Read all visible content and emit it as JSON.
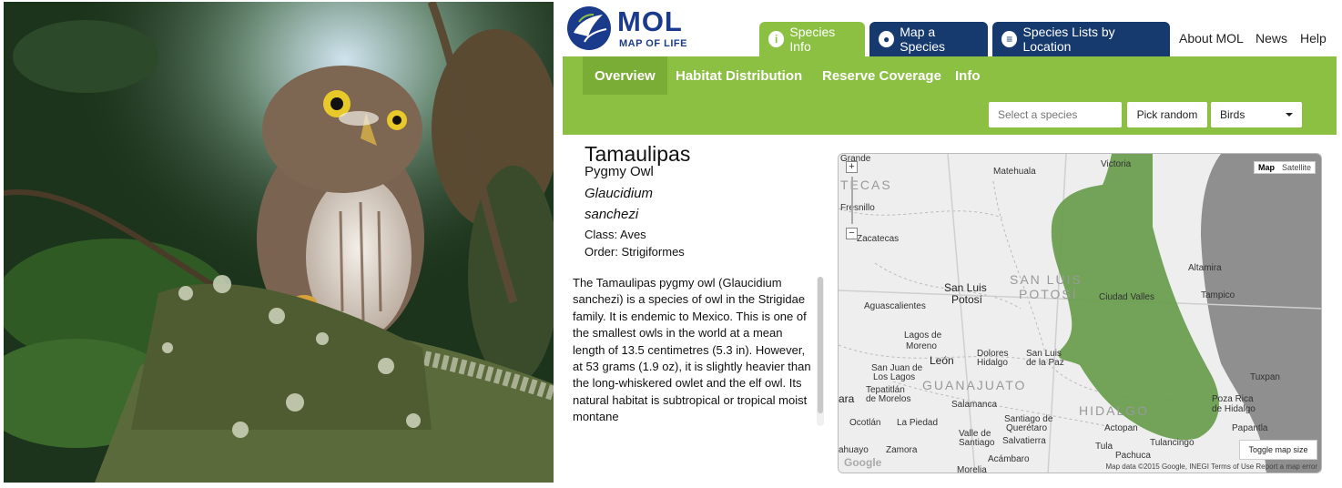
{
  "photo": {
    "alt_subject": "owl"
  },
  "logo": {
    "mol": "MOL",
    "subtitle": "MAP OF LIFE"
  },
  "tabs": [
    {
      "label": "Species Info",
      "icon": "info-icon"
    },
    {
      "label": "Map a Species",
      "icon": "map-pin-icon"
    },
    {
      "label": "Species Lists by Location",
      "icon": "list-icon"
    }
  ],
  "top_links": [
    "About MOL",
    "News",
    "Help"
  ],
  "subtabs": [
    "Overview",
    "Habitat Distribution",
    "Reserve Coverage",
    "Info"
  ],
  "search": {
    "placeholder": "Select a species"
  },
  "pick_random": "Pick random",
  "group_select": {
    "value": "Birds"
  },
  "species": {
    "common_line1": "Tamaulipas",
    "common_line2": "Pygmy Owl",
    "sci_line1": "Glaucidium",
    "sci_line2": "sanchezi",
    "class": "Class: Aves",
    "order": "Order: Strigiformes",
    "description": "The Tamaulipas pygmy owl (Glaucidium sanchezi) is a species of owl in the Strigidae family. It is endemic to Mexico. This is one of the smallest owls in the world at a mean length of 13.5 centimetres (5.3 in). However, at 53 grams (1.9 oz), it is slightly heavier than the long-whiskered owlet and the elf owl. Its natural habitat is subtropical or tropical moist montane"
  },
  "map": {
    "type_map": "Map",
    "type_satellite": "Satellite",
    "toggle": "Toggle map size",
    "attribution": "Map data ©2015 Google, INEGI   Terms of Use   Report a map error",
    "google": "Google",
    "zoom_in": "+",
    "zoom_out": "−",
    "range_color": "#6a9e4f",
    "labels": {
      "grande": "Grande",
      "tecas": "TECAS",
      "fresnillo": "Fresnillo",
      "zacatecas": "Zacatecas",
      "matehuala": "Matehuala",
      "victoria": "Victoria",
      "san_luis_state": "SAN LUIS",
      "potosi_state": "POTOSÍ",
      "san_luis_city": "San Luis",
      "potosi_city": "Potosí",
      "aguascalientes": "Aguascalientes",
      "ciudad_valles": "Ciudad Valles",
      "altamira": "Altamira",
      "tampico": "Tampico",
      "lagos_de": "Lagos de",
      "moreno": "Moreno",
      "leon": "León",
      "dolores": "Dolores",
      "hidalgo_city": "Hidalgo",
      "san_luis_paz": "San Luis",
      "de_la_paz": "de la Paz",
      "san_juan": "San Juan de",
      "los_lagos": "Los Lagos",
      "tepatitlan": "Tepatitlán",
      "de_morelos": "de Morelos",
      "ara": "ara",
      "guanajuato": "GUANAJUATO",
      "salamanca": "Salamanca",
      "hidalgo_state": "HIDALGO",
      "tuxpan": "Tuxpan",
      "poza_rica": "Poza Rica",
      "de_hidalgo": "de Hidalgo",
      "papantla": "Papantla",
      "ocotlan": "Ocotlán",
      "la_piedad": "La Piedad",
      "santiago_de": "Santiago de",
      "queretaro": "Querétaro",
      "valle_de": "Valle de",
      "santiago": "Santiago",
      "salvatierra": "Salvatierra",
      "actopan": "Actopan",
      "tulancingo": "Tulancingo",
      "tula": "Tula",
      "pachuca": "Pachuca",
      "zamora": "Zamora",
      "acambaro": "Acámbaro",
      "morelia": "Morelia",
      "ahuayo": "ahuayo"
    }
  }
}
